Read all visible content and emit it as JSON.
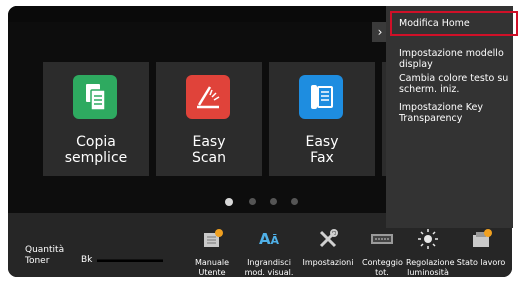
{
  "tiles": [
    {
      "line1": "Copia",
      "line2": "semplice",
      "color": "#2eaa60",
      "icon": "copy-icon"
    },
    {
      "line1": "Easy",
      "line2": "Scan",
      "color": "#e0433a",
      "icon": "scan-icon"
    },
    {
      "line1": "Easy",
      "line2": "Fax",
      "color": "#1e8de0",
      "icon": "fax-icon"
    }
  ],
  "menu": {
    "items": [
      "Modifica Home",
      "Impostazione modello display",
      "Cambia colore testo su scherm. iniz.",
      "Impostazione Key Transparency"
    ]
  },
  "toner": {
    "label": "Quantità Toner",
    "color_label": "Bk"
  },
  "bottom": {
    "manuale": "Manuale Utente",
    "ingrandisci": "Ingrandisci mod. visual.",
    "impostazioni": "Impostazioni",
    "conteggio": "Conteggio tot.",
    "regolazione": "Regolazione luminosità",
    "stato": "Stato lavoro"
  },
  "arrow": "›",
  "pager": {
    "count": 4,
    "active": 0
  },
  "colors": {
    "highlight": "#d01028",
    "panel": "#333333",
    "bar": "#262626"
  }
}
